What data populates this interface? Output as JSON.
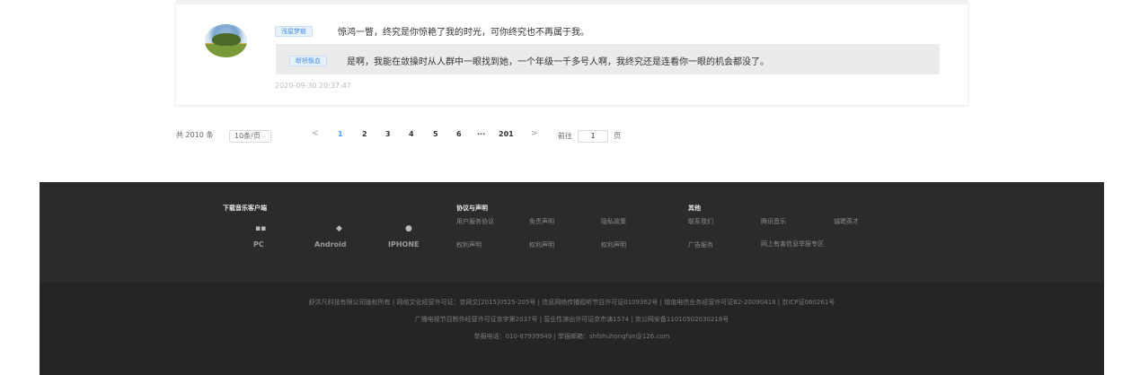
{
  "comment": {
    "tag": "浅星梦痕",
    "text": "惊鸿一瞥，终究是你惊艳了我的时光，可你终究也不再属于我。",
    "reply": {
      "tag": "断桥飘血",
      "text": "是啊，我能在敛操时从人群中一眼找到她，一个年级一千多号人啊，我终究还是连看你一眼的机会都没了。"
    },
    "timestamp": "2020-09-30 20:37:47"
  },
  "pagination": {
    "total": "共 2010 条",
    "page_size": "10条/页",
    "prev": "<",
    "pages": [
      "1",
      "2",
      "3",
      "4",
      "5",
      "6",
      "···",
      "201"
    ],
    "active_page": "1",
    "next": ">",
    "goto_label": "前往",
    "goto_value": "1",
    "goto_suffix": "页"
  },
  "footer": {
    "download": {
      "title": "下载音乐客户端",
      "platforms": [
        "PC",
        "Android",
        "IPHONE"
      ]
    },
    "agreements": {
      "title": "协议与声明",
      "links": [
        "用户服务协议",
        "免责声明",
        "隐私政策",
        "权利声明",
        "权利声明",
        "权利声明"
      ]
    },
    "other": {
      "title": "其他",
      "links": [
        "联系我们",
        "腾讯音乐",
        "诚聘英才",
        "广告服务",
        "网上有害信息举报专区"
      ]
    },
    "legal": [
      "舒洪凡科技有限公司版权所有 | 网络文化经营许可证：京网文[2015]0525-205号 | 信息网络传播视听节目许可证0109362号 | 增值电信业务经营许可证B2-20090418 | 京ICP证060261号",
      "广播电视节目制作经营许可证京字第2037号 | 营业性演出许可证京市演1574 | 京公网安备11010502030216号",
      "举报电话：010-87939949 | 举报邮箱：shfshuhongfan@126.com"
    ]
  }
}
